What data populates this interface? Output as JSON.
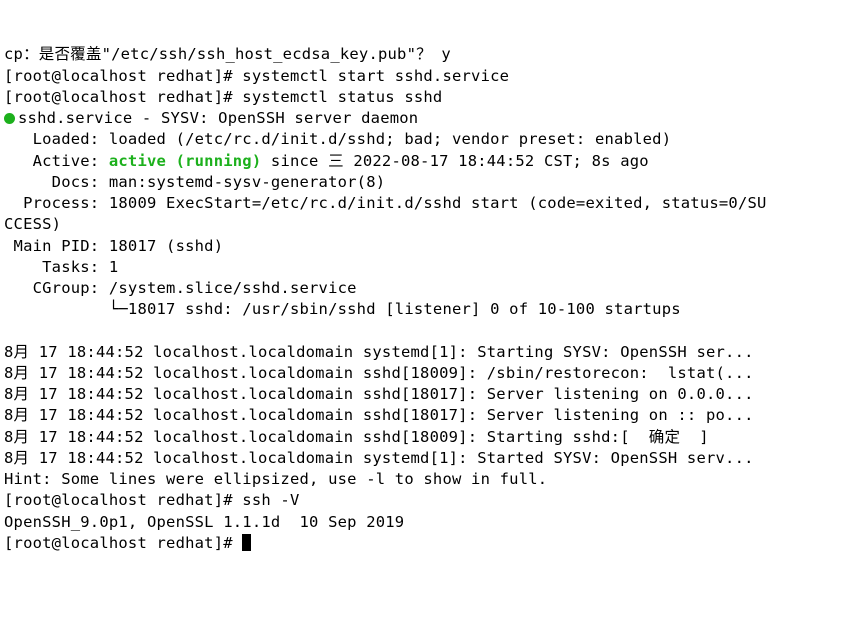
{
  "line1": "cp：是否覆盖\"/etc/ssh/ssh_host_ecdsa_key.pub\"？ y",
  "line2": "[root@localhost redhat]# systemctl start sshd.service",
  "line3": "[root@localhost redhat]# systemctl status sshd",
  "line4a": "sshd.service - SYSV: OpenSSH server daemon",
  "line5": "   Loaded: loaded (/etc/rc.d/init.d/sshd; bad; vendor preset: enabled)",
  "line6a": "   Active: ",
  "line6b": "active (running)",
  "line6c": " since 三 2022-08-17 18:44:52 CST; 8s ago",
  "line7": "     Docs: man:systemd-sysv-generator(8)",
  "line8": "  Process: 18009 ExecStart=/etc/rc.d/init.d/sshd start (code=exited, status=0/SU",
  "line9": "CCESS)",
  "line10": " Main PID: 18017 (sshd)",
  "line11": "    Tasks: 1",
  "line12": "   CGroup: /system.slice/sshd.service",
  "line13": "           └─18017 sshd: /usr/sbin/sshd [listener] 0 of 10-100 startups",
  "blank": "",
  "log1": "8月 17 18:44:52 localhost.localdomain systemd[1]: Starting SYSV: OpenSSH ser...",
  "log2": "8月 17 18:44:52 localhost.localdomain sshd[18009]: /sbin/restorecon:  lstat(...",
  "log3": "8月 17 18:44:52 localhost.localdomain sshd[18017]: Server listening on 0.0.0...",
  "log4": "8月 17 18:44:52 localhost.localdomain sshd[18017]: Server listening on :: po...",
  "log5": "8月 17 18:44:52 localhost.localdomain sshd[18009]: Starting sshd:[  确定  ]",
  "log6": "8月 17 18:44:52 localhost.localdomain systemd[1]: Started SYSV: OpenSSH serv...",
  "hint": "Hint: Some lines were ellipsized, use -l to show in full.",
  "cmd_sshv": "[root@localhost redhat]# ssh -V",
  "ssh_version": "OpenSSH_9.0p1, OpenSSL 1.1.1d  10 Sep 2019",
  "prompt_last": "[root@localhost redhat]# "
}
